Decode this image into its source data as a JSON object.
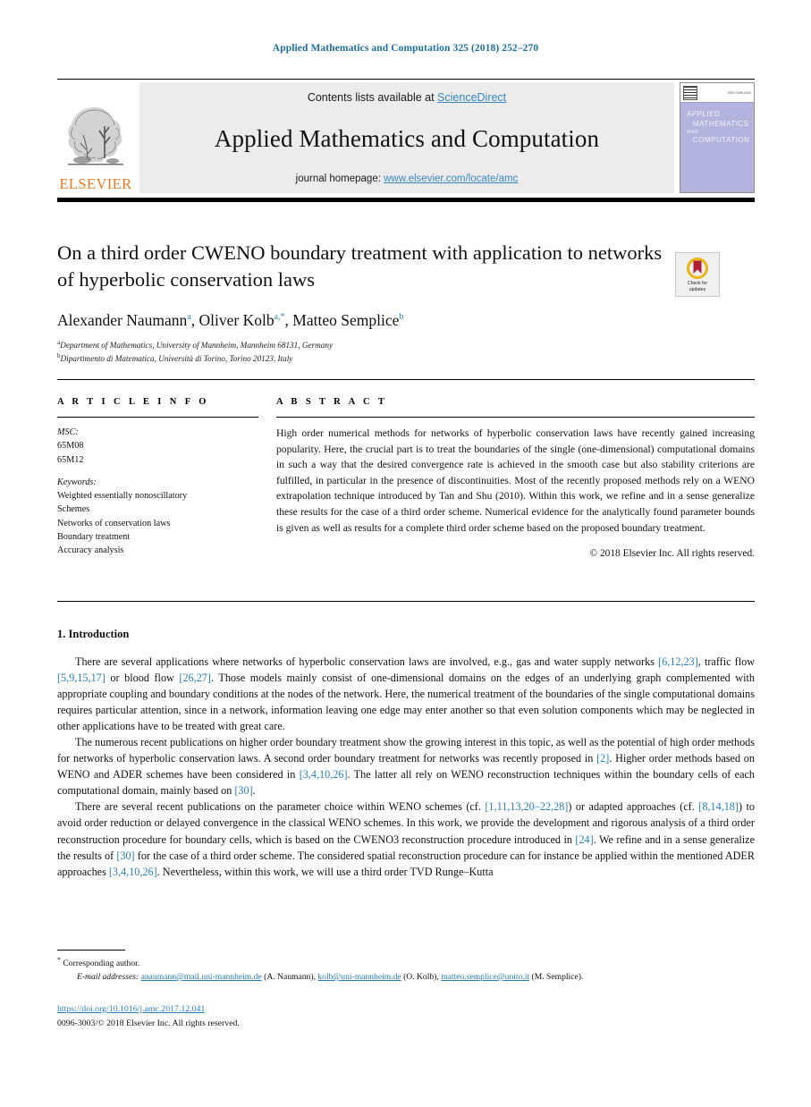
{
  "running_head": "Applied Mathematics and Computation 325 (2018) 252–270",
  "masthead": {
    "contents_prefix": "Contents lists available at ",
    "sciencedirect": "ScienceDirect",
    "journal_title": "Applied Mathematics and Computation",
    "homepage_prefix": "journal homepage: ",
    "homepage_url": "www.elsevier.com/locate/amc",
    "publisher_wordmark": "ELSEVIER",
    "link_color": "#3a87c0",
    "band_color": "#ececec"
  },
  "cover": {
    "line1": "APPLIED",
    "line2": "MATHEMATICS",
    "line3": "AND",
    "line4": "COMPUTATION",
    "corner_note": "ISSN 0096-3003",
    "background": "#b3b3dd"
  },
  "crossmark": {
    "line1": "Check for",
    "line2": "updates",
    "ring_color": "#e8b820",
    "mark_color": "#b02030"
  },
  "article": {
    "title": "On a third order CWENO boundary treatment with application to networks of hyperbolic conservation laws",
    "authors_html": "Alexander Naumann<sup>a</sup>, Oliver Kolb<sup>a,*</sup>, Matteo Semplice<sup>b</sup>",
    "affiliations": [
      {
        "marker": "a",
        "text": "Department of Mathematics, University of Mannheim, Mannheim 68131, Germany"
      },
      {
        "marker": "b",
        "text": "Dipartimento di Matematica, Università di Torino, Torino 20123, Italy"
      }
    ]
  },
  "info": {
    "heading": "A R T I C L E   I N F O",
    "msc_label": "MSC:",
    "msc_codes": [
      "65M08",
      "65M12"
    ],
    "keywords_label": "Keywords:",
    "keywords": [
      "Weighted essentially nonoscillatory",
      "Schemes",
      "Networks of conservation laws",
      "Boundary treatment",
      "Accuracy analysis"
    ]
  },
  "abstract": {
    "heading": "A B S T R A C T",
    "text": "High order numerical methods for networks of hyperbolic conservation laws have recently gained increasing popularity. Here, the crucial part is to treat the boundaries of the single (one-dimensional) computational domains in such a way that the desired convergence rate is achieved in the smooth case but also stability criterions are fulfilled, in particular in the presence of discontinuities. Most of the recently proposed methods rely on a WENO extrapolation technique introduced by Tan and Shu (2010). Within this work, we refine and in a sense generalize these results for the case of a third order scheme. Numerical evidence for the analytically found parameter bounds is given as well as results for a complete third order scheme based on the proposed boundary treatment.",
    "copyright": "© 2018 Elsevier Inc. All rights reserved."
  },
  "introduction": {
    "heading": "1. Introduction",
    "paragraphs": [
      [
        {
          "t": "There are several applications where networks of hyperbolic conservation laws are involved, e.g., gas and water supply networks "
        },
        {
          "t": "[6,12,23]",
          "cite": true
        },
        {
          "t": ", traffic flow "
        },
        {
          "t": "[5,9,15,17]",
          "cite": true
        },
        {
          "t": " or blood flow "
        },
        {
          "t": "[26,27]",
          "cite": true
        },
        {
          "t": ". Those models mainly consist of one-dimensional domains on the edges of an underlying graph complemented with appropriate coupling and boundary conditions at the nodes of the network. Here, the numerical treatment of the boundaries of the single computational domains requires particular attention, since in a network, information leaving one edge may enter another so that even solution components which may be neglected in other applications have to be treated with great care."
        }
      ],
      [
        {
          "t": "The numerous recent publications on higher order boundary treatment show the growing interest in this topic, as well as the potential of high order methods for networks of hyperbolic conservation laws. A second order boundary treatment for networks was recently proposed in "
        },
        {
          "t": "[2]",
          "cite": true
        },
        {
          "t": ". Higher order methods based on WENO and ADER schemes have been considered in "
        },
        {
          "t": "[3,4,10,26]",
          "cite": true
        },
        {
          "t": ". The latter all rely on WENO reconstruction techniques within the boundary cells of each computational domain, mainly based on "
        },
        {
          "t": "[30]",
          "cite": true
        },
        {
          "t": "."
        }
      ],
      [
        {
          "t": "There are several recent publications on the parameter choice within WENO schemes (cf. "
        },
        {
          "t": "[1,11,13,20–22,28]",
          "cite": true
        },
        {
          "t": ") or adapted approaches (cf. "
        },
        {
          "t": "[8,14,18]",
          "cite": true
        },
        {
          "t": ") to avoid order reduction or delayed convergence in the classical WENO schemes. In this work, we provide the development and rigorous analysis of a third order reconstruction procedure for boundary cells, which is based on the CWENO3 reconstruction procedure introduced in "
        },
        {
          "t": "[24]",
          "cite": true
        },
        {
          "t": ". We refine and in a sense generalize the results of "
        },
        {
          "t": "[30]",
          "cite": true
        },
        {
          "t": " for the case of a third order scheme. The considered spatial reconstruction procedure can for instance be applied within the mentioned ADER approaches "
        },
        {
          "t": "[3,4,10,26]",
          "cite": true
        },
        {
          "t": ". Nevertheless, within this work, we will use a third order TVD Runge–Kutta"
        }
      ]
    ]
  },
  "footer": {
    "corresponding_author": "Corresponding author.",
    "email_label": "E-mail addresses:",
    "emails": [
      {
        "address": "anaumann@mail.uni-mannheim.de",
        "name": "(A. Naumann)"
      },
      {
        "address": "kolb@uni-mannheim.de",
        "name": "(O. Kolb)"
      },
      {
        "address": "matteo.semplice@unito.it",
        "name": "(M. Semplice)"
      }
    ],
    "doi": "https://doi.org/10.1016/j.amc.2017.12.041",
    "issn_line": "0096-3003/© 2018 Elsevier Inc. All rights reserved."
  }
}
